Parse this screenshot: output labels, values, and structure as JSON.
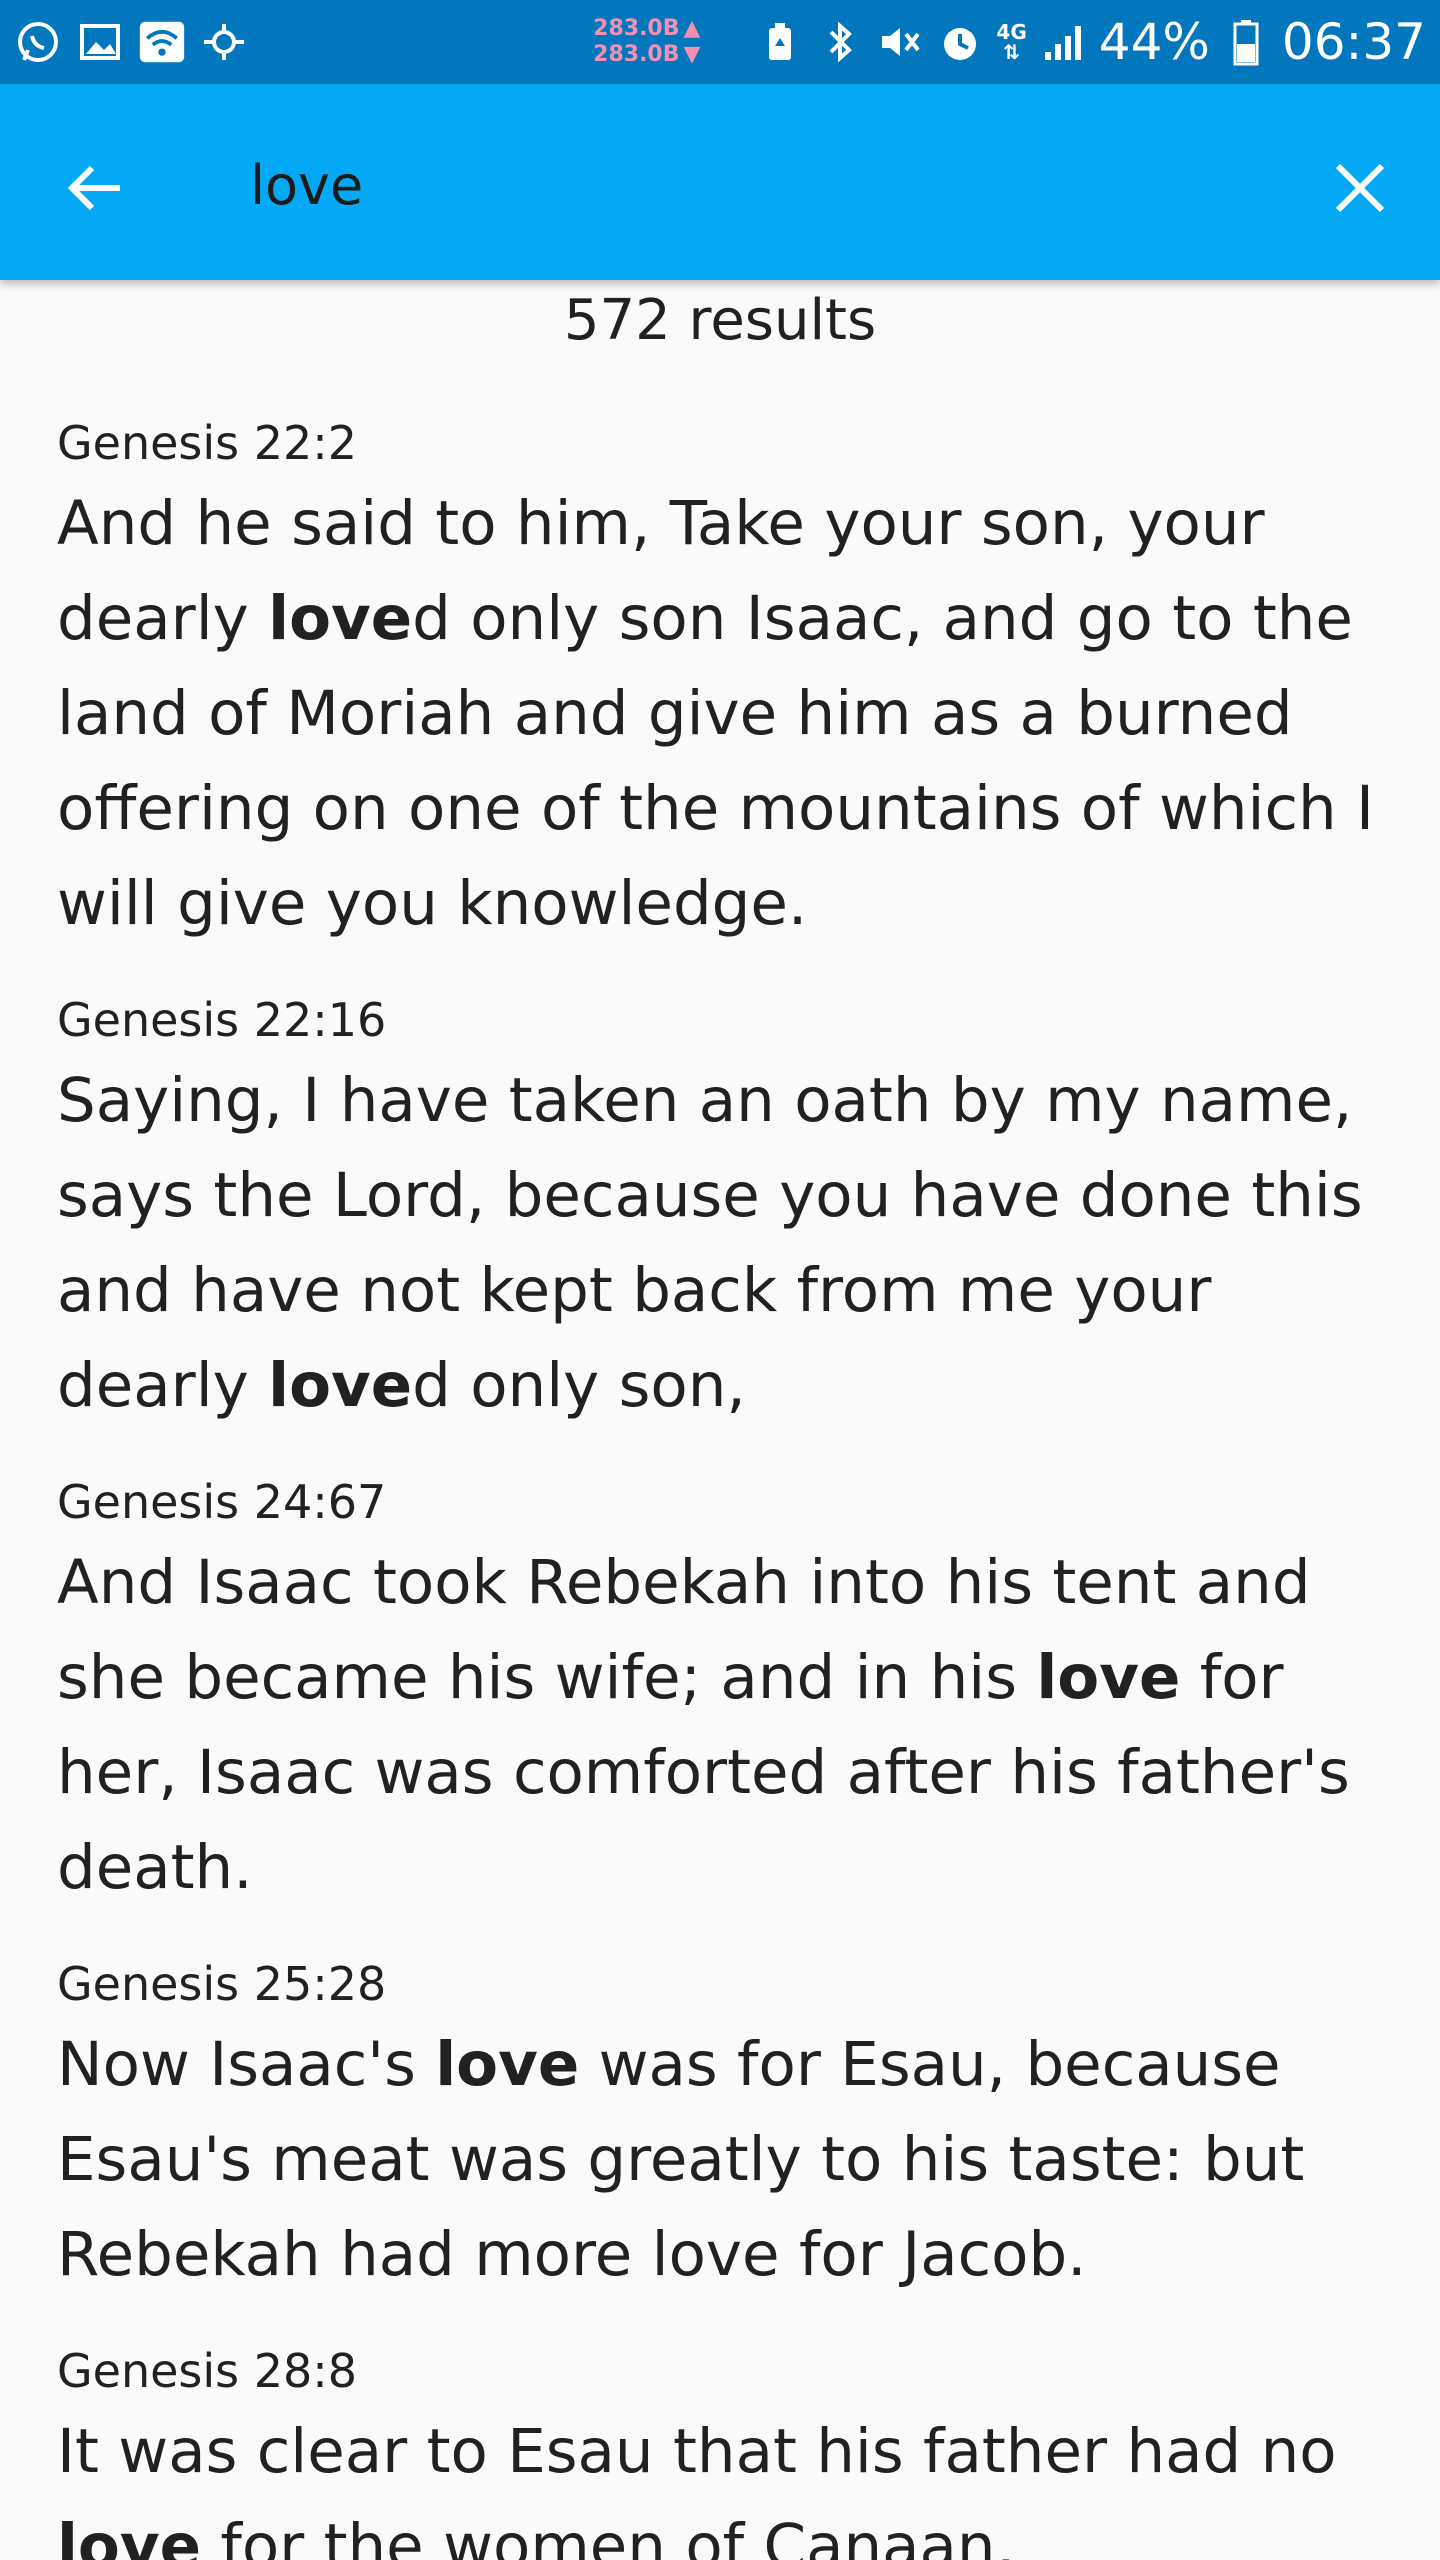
{
  "status_bar": {
    "net_up": "283.0B",
    "net_down": "283.0B",
    "network_type": "4G",
    "battery": "44%",
    "time": "06:37",
    "left_icons": [
      "whatsapp-icon",
      "gallery-icon",
      "wifi-icon",
      "location-icon"
    ],
    "right_icons": [
      "battery-saver-icon",
      "bluetooth-icon",
      "mute-icon",
      "alarm-icon",
      "signal-icon",
      "battery-icon"
    ]
  },
  "search": {
    "query": "love",
    "back_icon": "arrow-left-icon",
    "close_icon": "close-icon"
  },
  "results_count": "572 results",
  "results": [
    {
      "ref": "Genesis 22:2",
      "before": "And he said to him, Take your son, your dearly ",
      "highlight": "love",
      "after": "d only son Isaac, and go to the land of Moriah and give him as a burned offering on one of the mountains of which I will give you knowledge."
    },
    {
      "ref": "Genesis 22:16",
      "before": "Saying, I have taken an oath by my name, says the Lord, because you have done this and have not kept back from me your dearly ",
      "highlight": "love",
      "after": "d only son,"
    },
    {
      "ref": "Genesis 24:67",
      "before": "And Isaac took Rebekah into his tent and she became his wife; and in his ",
      "highlight": "love",
      "after": " for her, Isaac was comforted after his father's death."
    },
    {
      "ref": "Genesis 25:28",
      "before": "Now Isaac's ",
      "highlight": "love",
      "after": " was for Esau, because Esau's meat was greatly to his taste: but Rebekah had more love for Jacob."
    },
    {
      "ref": "Genesis 28:8",
      "before": "It was clear to Esau that his father had no ",
      "highlight": "love",
      "after": " for the women of Canaan,"
    }
  ],
  "colors": {
    "status_bar": "#0277bd",
    "app_bar": "#03a9f4",
    "background": "#fafafa",
    "net_speed": "#f48fb1"
  }
}
